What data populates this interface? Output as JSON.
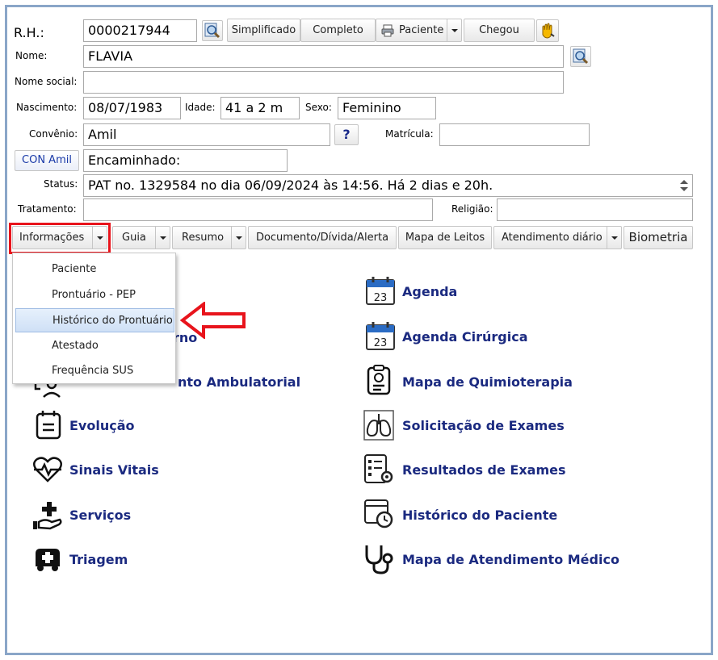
{
  "form": {
    "rh_label": "R.H.:",
    "rh_value": "0000217944",
    "nome_label": "Nome:",
    "nome_value": "FLAVIA",
    "nome_social_label": "Nome social:",
    "nome_social_value": "",
    "nascimento_label": "Nascimento:",
    "nascimento_value": "08/07/1983",
    "idade_label": "Idade:",
    "idade_value": "41 a 2 m",
    "sexo_label": "Sexo:",
    "sexo_value": "Feminino",
    "convenio_label": "Convênio:",
    "convenio_value": "Amil",
    "help_label": "?",
    "matricula_label": "Matrícula:",
    "matricula_value": "",
    "con_button": "CON Amil",
    "encaminhado_value": "Encaminhado:",
    "status_label": "Status:",
    "status_value": "PAT no. 1329584 no dia 06/09/2024  às  14:56. Há 2 dias e 20h.",
    "tratamento_label": "Tratamento:",
    "tratamento_value": "",
    "religiao_label": "Religião:",
    "religiao_value": ""
  },
  "top_buttons": {
    "simplificado": "Simplificado",
    "completo": "Completo",
    "paciente": "Paciente",
    "chegou": "Chegou"
  },
  "toolbar": {
    "informacoes": "Informações",
    "guia": "Guia",
    "resumo": "Resumo",
    "documento": "Documento/Dívida/Alerta",
    "mapa_leitos": "Mapa de Leitos",
    "atendimento": "Atendimento diário",
    "biometria": "Biometria"
  },
  "dropdown": {
    "items": [
      "Paciente",
      "Prontuário - PEP",
      "Histórico do Prontuário",
      "Atestado",
      "Frequência SUS"
    ]
  },
  "left_menu": {
    "partial_1": "rno",
    "partial_2": "nto Ambulatorial",
    "evolucao": "Evolução",
    "sinais_vitais": "Sinais Vitais",
    "servicos": "Serviços",
    "triagem": "Triagem"
  },
  "right_menu": {
    "agenda": "Agenda",
    "agenda_day": "23",
    "agenda_cirurgica": "Agenda Cirúrgica",
    "agenda_cirurgica_day": "23",
    "mapa_quimio": "Mapa de Quimioterapia",
    "solicitacao_exames": "Solicitação de Exames",
    "resultados_exames": "Resultados de Exames",
    "historico_paciente": "Histórico do Paciente",
    "mapa_atendimento": "Mapa de Atendimento Médico"
  },
  "colors": {
    "menu_text": "#1b2a80",
    "highlight": "#e8141c",
    "frame": "#8aa6c8"
  }
}
